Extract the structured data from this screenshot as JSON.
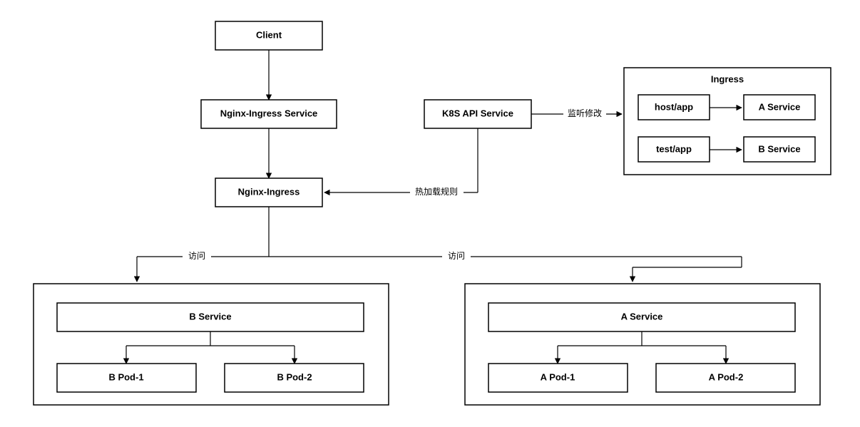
{
  "nodes": {
    "client": "Client",
    "nginx_ingress_service": "Nginx-Ingress Service",
    "nginx_ingress": "Nginx-Ingress",
    "k8s_api": "K8S API Service",
    "ingress_title": "Ingress",
    "host_app": "host/app",
    "a_service_small": "A Service",
    "test_app": "test/app",
    "b_service_small": "B Service",
    "b_service": "B Service",
    "b_pod_1": "B Pod-1",
    "b_pod_2": "B Pod-2",
    "a_service": "A Service",
    "a_pod_1": "A Pod-1",
    "a_pod_2": "A Pod-2"
  },
  "edges": {
    "listen_modify": "监听修改",
    "hot_reload": "热加载规则",
    "visit_left": "访问",
    "visit_right": "访问"
  }
}
